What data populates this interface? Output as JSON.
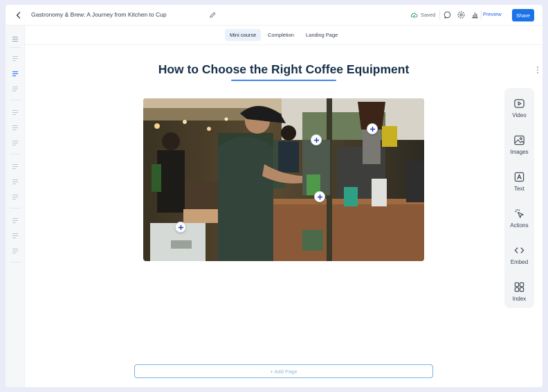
{
  "header": {
    "title": "Gastronomy & Brew: A Journey from Kitchen to Cup",
    "saved_label": "Saved",
    "preview_label": "Preview",
    "share_label": "Share",
    "icons": [
      "back-arrow-icon",
      "pencil-icon",
      "cloud-check-icon",
      "comment-icon",
      "settings-icon",
      "analytics-icon"
    ]
  },
  "tabs": [
    {
      "label": "Mini course",
      "active": true
    },
    {
      "label": "Completion",
      "active": false
    },
    {
      "label": "Landing Page",
      "active": false
    }
  ],
  "main": {
    "heading": "How to Choose the Right Coffee Equipment",
    "image_icon": "coffee-stall-photo",
    "add_page_label": "+ Add Page"
  },
  "tools": [
    {
      "label": "Video",
      "icon": "video-icon"
    },
    {
      "label": "Images",
      "icon": "image-icon"
    },
    {
      "label": "Text",
      "icon": "text-icon"
    },
    {
      "label": "Actions",
      "icon": "pointer-icon"
    },
    {
      "label": "Embed",
      "icon": "code-icon"
    },
    {
      "label": "Index",
      "icon": "grid-icon"
    }
  ],
  "colors": {
    "accent": "#1a73e8",
    "heading": "#17304a",
    "background": "#e9ecf8"
  }
}
